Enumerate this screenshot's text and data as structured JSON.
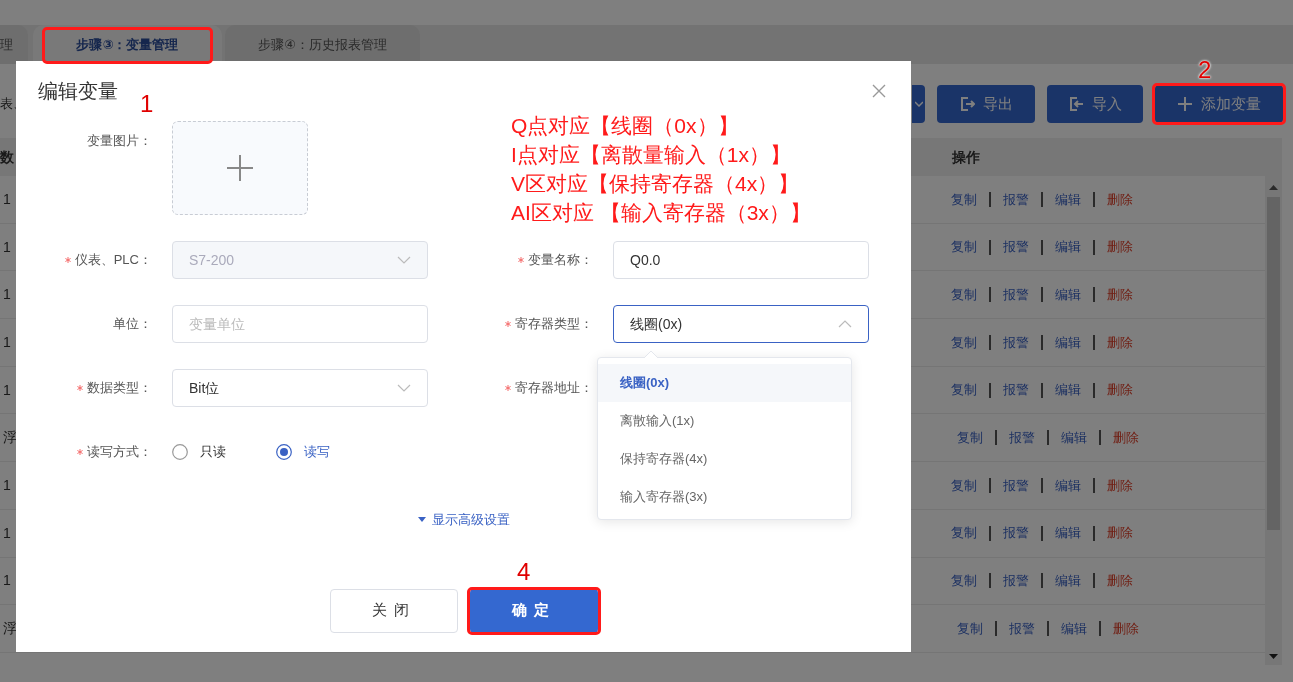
{
  "tabs": [
    {
      "label": "理",
      "selected": false
    },
    {
      "label": "步骤③：变量管理",
      "selected": true,
      "highlighted": true
    },
    {
      "label": "步骤④：历史报表管理",
      "selected": false
    }
  ],
  "toolbar": {
    "left_text": "表、",
    "buttons": [
      {
        "kind": "dropdown"
      },
      {
        "kind": "export",
        "label": "导出"
      },
      {
        "kind": "import",
        "label": "导入"
      },
      {
        "kind": "add",
        "label": "添加变量",
        "highlighted": true
      }
    ]
  },
  "table": {
    "columns": [
      {
        "label": "数"
      },
      {
        "label": "操作"
      }
    ],
    "rows": [
      {
        "column_1": "1",
        "actions": [
          {
            "kind": "copy",
            "label": "复制"
          },
          {
            "kind": "alarm",
            "label": "报警"
          },
          {
            "kind": "edit",
            "label": "编辑"
          },
          {
            "kind": "delete",
            "label": "删除"
          }
        ]
      },
      {
        "column_1": "1",
        "actions": [
          {
            "kind": "copy",
            "label": "复制"
          },
          {
            "kind": "alarm",
            "label": "报警"
          },
          {
            "kind": "edit",
            "label": "编辑"
          },
          {
            "kind": "delete",
            "label": "删除"
          }
        ]
      },
      {
        "column_1": "1",
        "actions": [
          {
            "kind": "copy",
            "label": "复制"
          },
          {
            "kind": "alarm",
            "label": "报警"
          },
          {
            "kind": "edit",
            "label": "编辑"
          },
          {
            "kind": "delete",
            "label": "删除"
          }
        ]
      },
      {
        "column_1": "1",
        "actions": [
          {
            "kind": "copy",
            "label": "复制"
          },
          {
            "kind": "alarm",
            "label": "报警"
          },
          {
            "kind": "edit",
            "label": "编辑"
          },
          {
            "kind": "delete",
            "label": "删除"
          }
        ]
      },
      {
        "column_1": "1",
        "actions": [
          {
            "kind": "copy",
            "label": "复制"
          },
          {
            "kind": "alarm",
            "label": "报警"
          },
          {
            "kind": "edit",
            "label": "编辑"
          },
          {
            "kind": "delete",
            "label": "删除"
          }
        ]
      },
      {
        "column_1": "浮",
        "actions": [
          {
            "kind": "copy",
            "label": "复制"
          },
          {
            "kind": "alarm",
            "label": "报警"
          },
          {
            "kind": "edit",
            "label": "编辑"
          },
          {
            "kind": "delete",
            "label": "删除"
          }
        ]
      },
      {
        "column_1": "1",
        "actions": [
          {
            "kind": "copy",
            "label": "复制"
          },
          {
            "kind": "alarm",
            "label": "报警"
          },
          {
            "kind": "edit",
            "label": "编辑"
          },
          {
            "kind": "delete",
            "label": "删除"
          }
        ]
      },
      {
        "column_1": "1",
        "actions": [
          {
            "kind": "copy",
            "label": "复制"
          },
          {
            "kind": "alarm",
            "label": "报警"
          },
          {
            "kind": "edit",
            "label": "编辑"
          },
          {
            "kind": "delete",
            "label": "删除"
          }
        ]
      },
      {
        "column_1": "1",
        "actions": [
          {
            "kind": "copy",
            "label": "复制"
          },
          {
            "kind": "alarm",
            "label": "报警"
          },
          {
            "kind": "edit",
            "label": "编辑"
          },
          {
            "kind": "delete",
            "label": "删除"
          }
        ]
      },
      {
        "column_1": "浮",
        "actions": [
          {
            "kind": "copy",
            "label": "复制"
          },
          {
            "kind": "alarm",
            "label": "报警"
          },
          {
            "kind": "edit",
            "label": "编辑"
          },
          {
            "kind": "delete",
            "label": "删除"
          }
        ]
      }
    ]
  },
  "dialog": {
    "title": "编辑变量",
    "image_field": {
      "label": "变量图片："
    },
    "left_fields": [
      {
        "kind": "select",
        "label": "仪表、PLC：",
        "required": true,
        "value": "S7-200",
        "disabled": true
      },
      {
        "kind": "text",
        "label": "单位：",
        "required": false,
        "placeholder": "变量单位"
      },
      {
        "kind": "select",
        "label": "数据类型：",
        "required": true,
        "value": "Bit位",
        "disabled": false
      },
      {
        "kind": "radio",
        "label": "读写方式：",
        "required": true,
        "options": [
          {
            "label": "只读",
            "selected": false
          },
          {
            "label": "读写",
            "selected": true
          }
        ]
      }
    ],
    "right_fields": [
      {
        "kind": "text",
        "label": "变量名称：",
        "required": true,
        "value": "Q0.0"
      },
      {
        "kind": "select",
        "label": "寄存器类型：",
        "required": true,
        "value": "线圈(0x)",
        "disabled": false,
        "expanded": true,
        "options": [
          {
            "label": "线圈(0x)",
            "selected": true
          },
          {
            "label": "离散输入(1x)",
            "selected": false
          },
          {
            "label": "保持寄存器(4x)",
            "selected": false
          },
          {
            "label": "输入寄存器(3x)",
            "selected": false
          }
        ]
      },
      {
        "kind": "label",
        "label": "寄存器地址：",
        "required": true
      }
    ],
    "advanced_link": "显示高级设置",
    "buttons": [
      {
        "kind": "cancel",
        "label": "关闭"
      },
      {
        "kind": "primary",
        "label": "确定",
        "highlighted": true
      }
    ]
  },
  "annotations": {
    "notes": [
      "Q点对应【线圈（0x）】",
      "I点对应【离散量输入（1x）】",
      "V区对应【保持寄存器（4x）】",
      "AI区对应 【输入寄存器（3x）】"
    ],
    "markers": [
      "1",
      "2",
      "4"
    ]
  }
}
